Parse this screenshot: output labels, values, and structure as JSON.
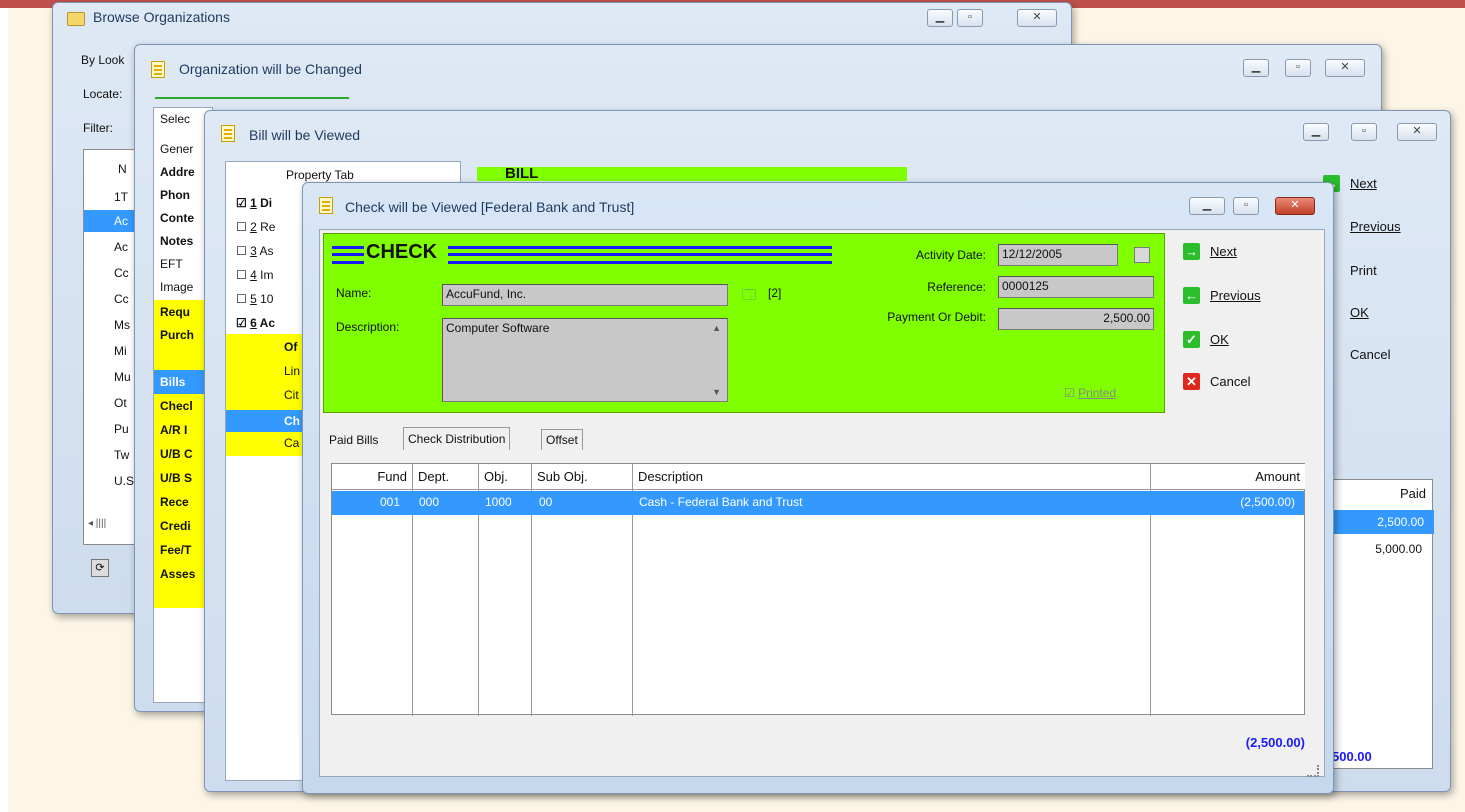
{
  "browse_window": {
    "title": "Browse Organizations",
    "by_lookup_label": "By Look",
    "locate_label": "Locate:",
    "filter_label": "Filter:",
    "list_header": "N",
    "list_items": [
      "1T",
      "Ac",
      "Ac",
      "Cc",
      "Cc",
      "Ms",
      "Mi",
      "Mu",
      "Ot",
      "Pu",
      "Tw",
      "U.S"
    ],
    "scroll_label": "◂ ||||"
  },
  "org_window": {
    "title": "Organization will be Changed",
    "tabs_header": "Selec",
    "tabs": [
      "Gener",
      "Addre",
      "Phon",
      "Conte",
      "Notes",
      "EFT",
      "Image",
      "Requ",
      "Purch",
      "Bills",
      "Checl",
      "A/R I",
      "U/B C",
      "U/B S",
      "Rece",
      "Credi",
      "Fee/T",
      "Asses"
    ]
  },
  "bill_window": {
    "title": "Bill will be Viewed",
    "property_tab_header": "Property Tab",
    "property_items": [
      {
        "checked": true,
        "num": "1",
        "label": "Di"
      },
      {
        "checked": false,
        "num": "2",
        "label": "Re"
      },
      {
        "checked": false,
        "num": "3",
        "label": "As"
      },
      {
        "checked": false,
        "num": "4",
        "label": "Im"
      },
      {
        "checked": false,
        "num": "5",
        "label": "10"
      },
      {
        "checked": true,
        "num": "6",
        "label": "Ac"
      }
    ],
    "sub_items": [
      "Of",
      "Lin",
      "Cit",
      "Ch",
      "Ca"
    ],
    "header_text": "BILL",
    "nav": {
      "next": "Next",
      "previous": "Previous",
      "print": "Print",
      "ok": "OK",
      "cancel": "Cancel"
    },
    "paid_header": "Paid",
    "paid_values": [
      "2,500.00",
      "5,000.00"
    ],
    "total": "500.00"
  },
  "check_window": {
    "title": "Check will be Viewed [Federal Bank and Trust]",
    "header_text": "CHECK",
    "name_label": "Name:",
    "name_value": "AccuFund, Inc.",
    "name_count": "[2]",
    "description_label": "Description:",
    "description_value": "Computer Software",
    "activity_date_label": "Activity Date:",
    "activity_date_value": "12/12/2005",
    "reference_label": "Reference:",
    "reference_value": "0000125",
    "payment_label": "Payment Or Debit:",
    "payment_value": "2,500.00",
    "printed_label": "Printed",
    "printed_checked": true,
    "nav": {
      "next": "Next",
      "previous": "Previous",
      "ok": "OK",
      "cancel": "Cancel"
    },
    "tabs": [
      "Paid Bills",
      "Check Distribution",
      "Offset"
    ],
    "active_tab": "Check Distribution",
    "columns": [
      "Fund",
      "Dept.",
      "Obj.",
      "Sub Obj.",
      "Description",
      "Amount"
    ],
    "rows": [
      {
        "fund": "001",
        "dept": "000",
        "obj": "1000",
        "sub_obj": "00",
        "description": "Cash - Federal Bank and Trust",
        "amount": "(2,500.00)"
      }
    ],
    "total": "(2,500.00)"
  },
  "colors": {
    "accent_green": "#80ff00",
    "selection": "#3399ff",
    "highlight_yellow": "#ffff00",
    "total_blue": "#1a1aff"
  }
}
